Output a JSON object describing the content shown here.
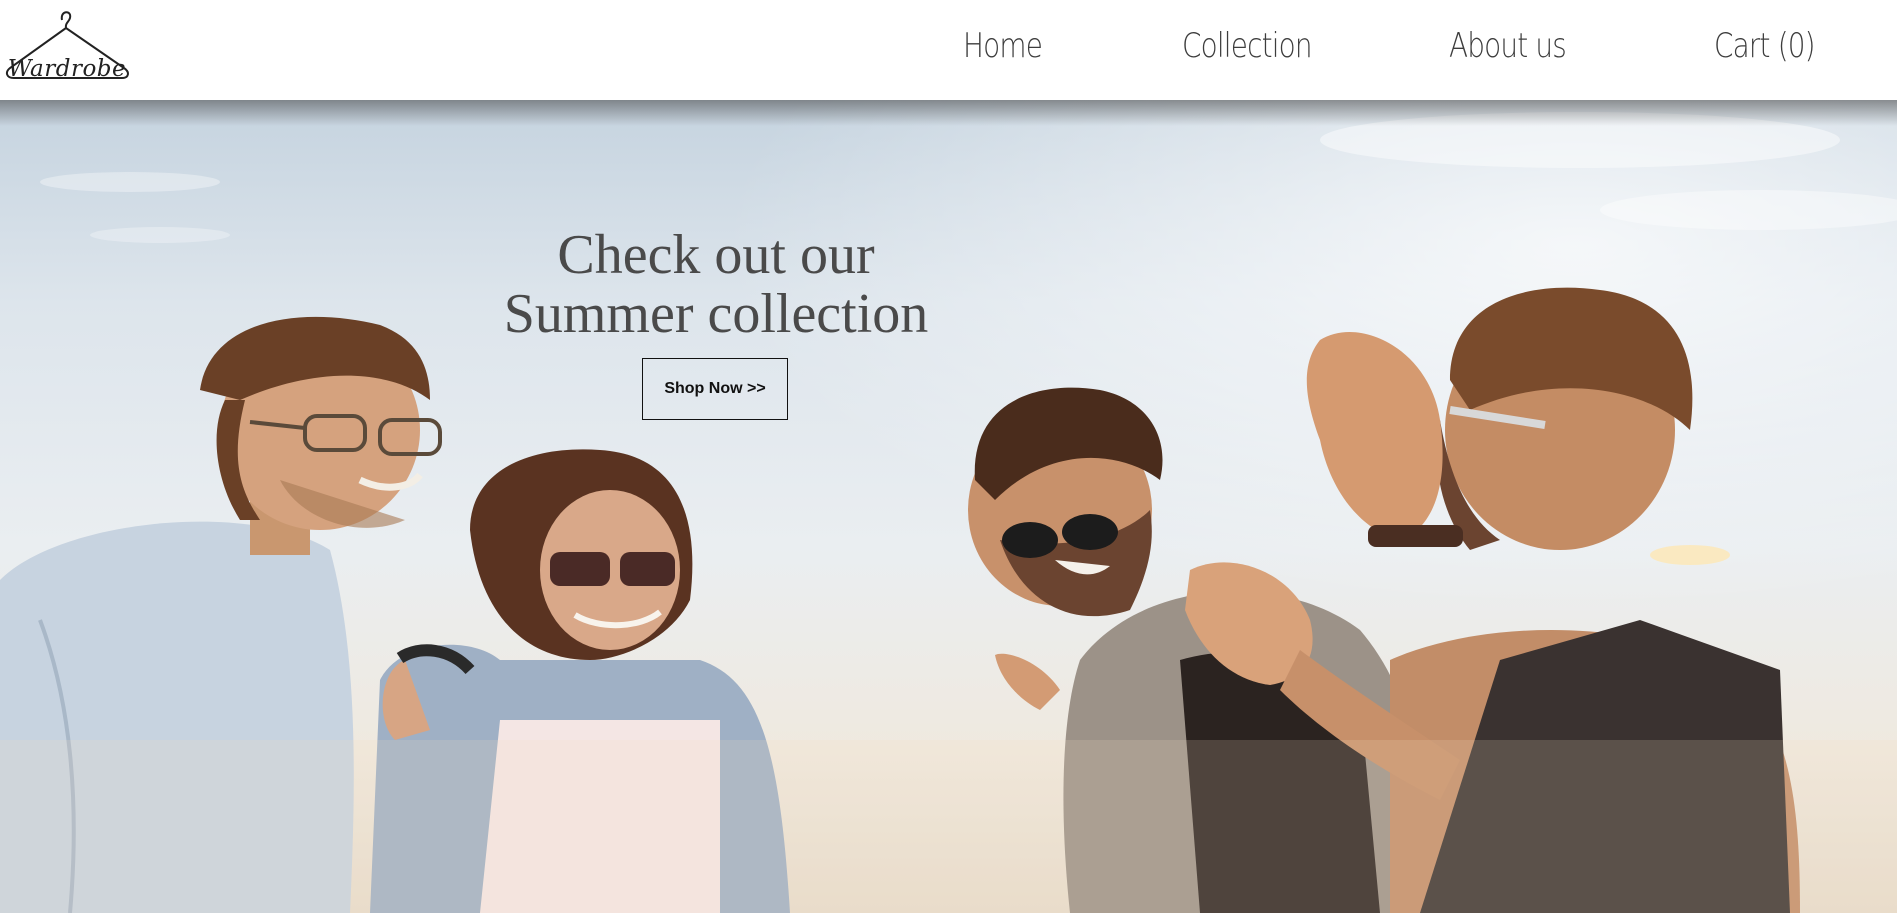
{
  "header": {
    "logo_text": "Wardrobe",
    "nav": [
      {
        "label": "Home"
      },
      {
        "label": "Collection"
      },
      {
        "label": "About us"
      },
      {
        "label": "Cart (0)"
      }
    ]
  },
  "hero": {
    "headline_line1": "Check out our",
    "headline_line2": "Summer collection",
    "cta_label": "Shop Now >>"
  },
  "colors": {
    "nav_text": "#3d3d3d",
    "headline_text": "#4a4a4a",
    "button_border": "#111111"
  }
}
